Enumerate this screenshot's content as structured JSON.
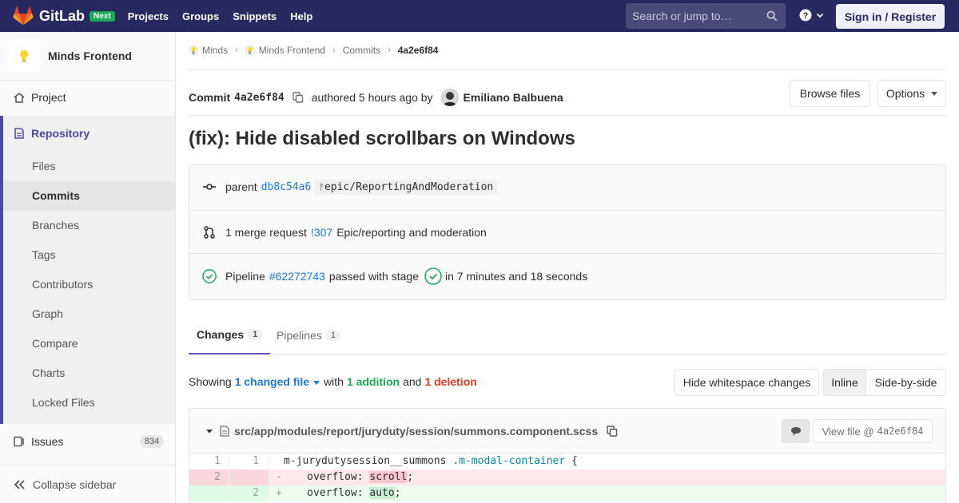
{
  "navbar": {
    "brand": "GitLab",
    "badge": "Next",
    "links": [
      "Projects",
      "Groups",
      "Snippets",
      "Help"
    ],
    "search_placeholder": "Search or jump to…",
    "signin": "Sign in / Register"
  },
  "sidebar": {
    "project_name": "Minds Frontend",
    "project": "Project",
    "repository": "Repository",
    "repo_items": [
      "Files",
      "Commits",
      "Branches",
      "Tags",
      "Contributors",
      "Graph",
      "Compare",
      "Charts",
      "Locked Files"
    ],
    "issues": "Issues",
    "issues_count": "834",
    "collapse": "Collapse sidebar"
  },
  "breadcrumb": [
    "Minds",
    "Minds Frontend",
    "Commits",
    "4a2e6f84"
  ],
  "commit": {
    "label": "Commit",
    "sha": "4a2e6f84",
    "authored": "authored 5 hours ago by",
    "author": "Emiliano Balbuena",
    "browse_files": "Browse files",
    "options": "Options",
    "title": "(fix): Hide disabled scrollbars on Windows"
  },
  "info": {
    "parent_label": "parent",
    "parent_sha": "db8c54a6",
    "branch": "epic/ReportingAndModeration",
    "mr_prefix": "1 merge request",
    "mr_link": "!307",
    "mr_title": "Epic/reporting and moderation",
    "pipeline_label": "Pipeline",
    "pipeline_link": "#62272743",
    "pipeline_passed": "passed with stage",
    "pipeline_time": "in 7 minutes and 18 seconds"
  },
  "tabs": [
    {
      "label": "Changes",
      "count": "1"
    },
    {
      "label": "Pipelines",
      "count": "1"
    }
  ],
  "stats": {
    "showing": "Showing",
    "changed": "1 changed file",
    "with": "with",
    "additions": "1 addition",
    "and": "and",
    "deletions": "1 deletion",
    "hide_whitespace": "Hide whitespace changes",
    "inline": "Inline",
    "side_by_side": "Side-by-side"
  },
  "diff": {
    "file_path": "src/app/modules/report/juryduty/session/summons.component.scss",
    "view_file": "View file @",
    "view_sha": "4a2e6f84",
    "lines": [
      {
        "old": "1",
        "new": "1",
        "sign": " ",
        "pre": "m-jurydutysession__summons ",
        "token": ".m-modal-container",
        "post": " {"
      },
      {
        "old": "2",
        "new": "",
        "sign": "-",
        "pre": "  overflow: ",
        "token": "scroll",
        "post": ";"
      },
      {
        "old": "",
        "new": "2",
        "sign": "+",
        "pre": "  overflow: ",
        "token": "auto",
        "post": ";"
      }
    ]
  },
  "colors": {
    "navbar": "#292961",
    "accent": "#4b4ba3",
    "link": "#1f78d1",
    "success": "#1aaa55",
    "danger": "#db3b21"
  }
}
